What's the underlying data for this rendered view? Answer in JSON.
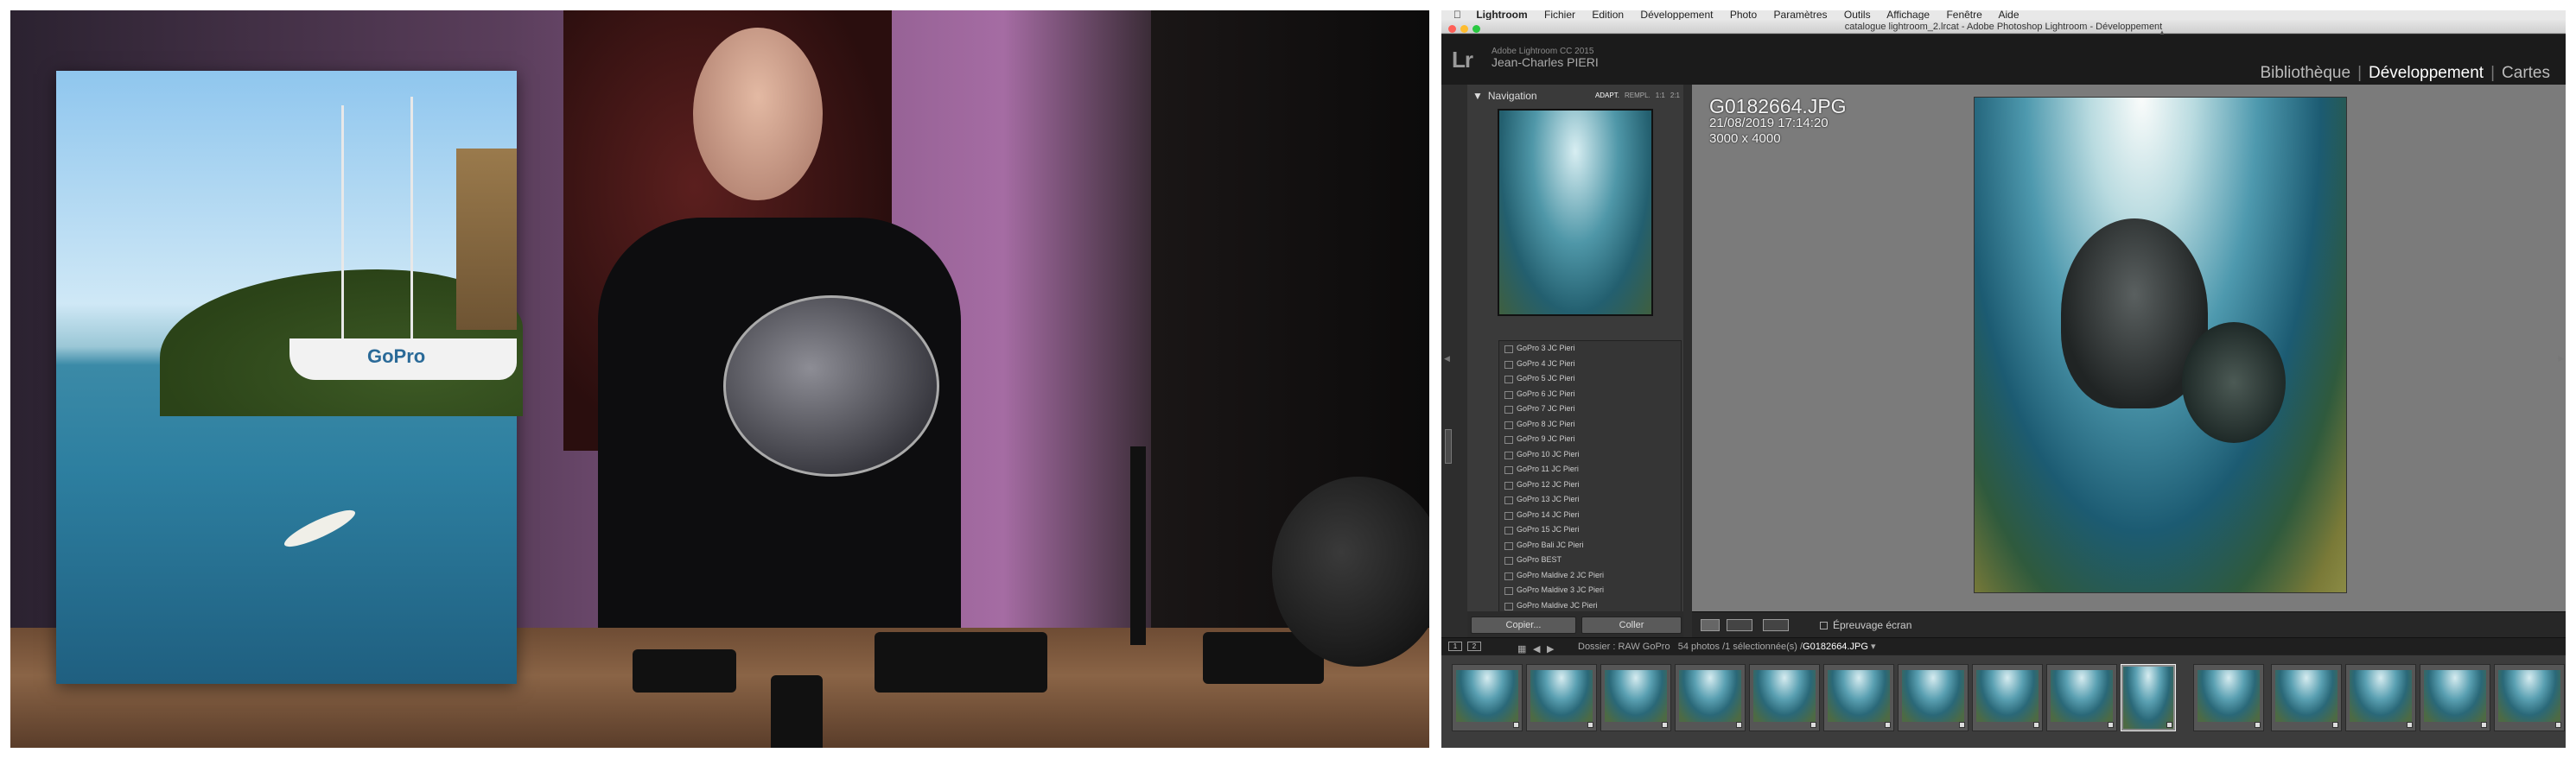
{
  "menubar": {
    "apple": "",
    "app": "Lightroom",
    "items": [
      "Fichier",
      "Edition",
      "Développement",
      "Photo",
      "Paramètres",
      "Outils",
      "Affichage",
      "Fenêtre",
      "Aide"
    ]
  },
  "window": {
    "title": "catalogue lightroom_2.lrcat - Adobe Photoshop Lightroom - Développement"
  },
  "identity": {
    "logo": "Lr",
    "product": "Adobe Lightroom CC 2015",
    "user": "Jean-Charles PIERI"
  },
  "modules": {
    "library": "Bibliothèque",
    "develop": "Développement",
    "maps": "Cartes",
    "separator": "|"
  },
  "navigator": {
    "title": "Navigation",
    "zoom": [
      "ADAPT.",
      "REMPL.",
      "1:1",
      "2:1"
    ]
  },
  "collections": [
    "GoPro 3 JC Pieri",
    "GoPro 4 JC Pieri",
    "GoPro 5 JC Pieri",
    "GoPro 6 JC Pieri",
    "GoPro 7 JC Pieri",
    "GoPro 8 JC Pieri",
    "GoPro 9 JC Pieri",
    "GoPro 10 JC Pieri",
    "GoPro 11 JC Pieri",
    "GoPro 12 JC Pieri",
    "GoPro 13 JC Pieri",
    "GoPro 14 JC Pieri",
    "GoPro 15 JC Pieri",
    "GoPro Bali JC Pieri",
    "GoPro BEST",
    "GoPro Maldive 2 JC Pieri",
    "GoPro Maldive 3 JC Pieri",
    "GoPro Maldive JC Pieri"
  ],
  "left_buttons": {
    "copy": "Copier...",
    "paste": "Coller"
  },
  "photo": {
    "filename": "G0182664.JPG",
    "datetime": "21/08/2019 17:14:20",
    "dimensions": "3000 x 4000"
  },
  "toolbar": {
    "soft_proof": "Épreuvage écran"
  },
  "filmstrip": {
    "monitor1": "1",
    "monitor2": "2",
    "source_prefix": "Dossier : RAW GoPro",
    "count": "54 photos /1 sélectionnée(s) /",
    "selected": "G0182664.JPG"
  },
  "video": {
    "brand": "GoPro"
  },
  "colors": {
    "lr_bg": "#2d2d2d",
    "lr_center": "#7b7b7b",
    "close": "#ff5f57",
    "minimize": "#febc2e",
    "zoom": "#28c840"
  }
}
